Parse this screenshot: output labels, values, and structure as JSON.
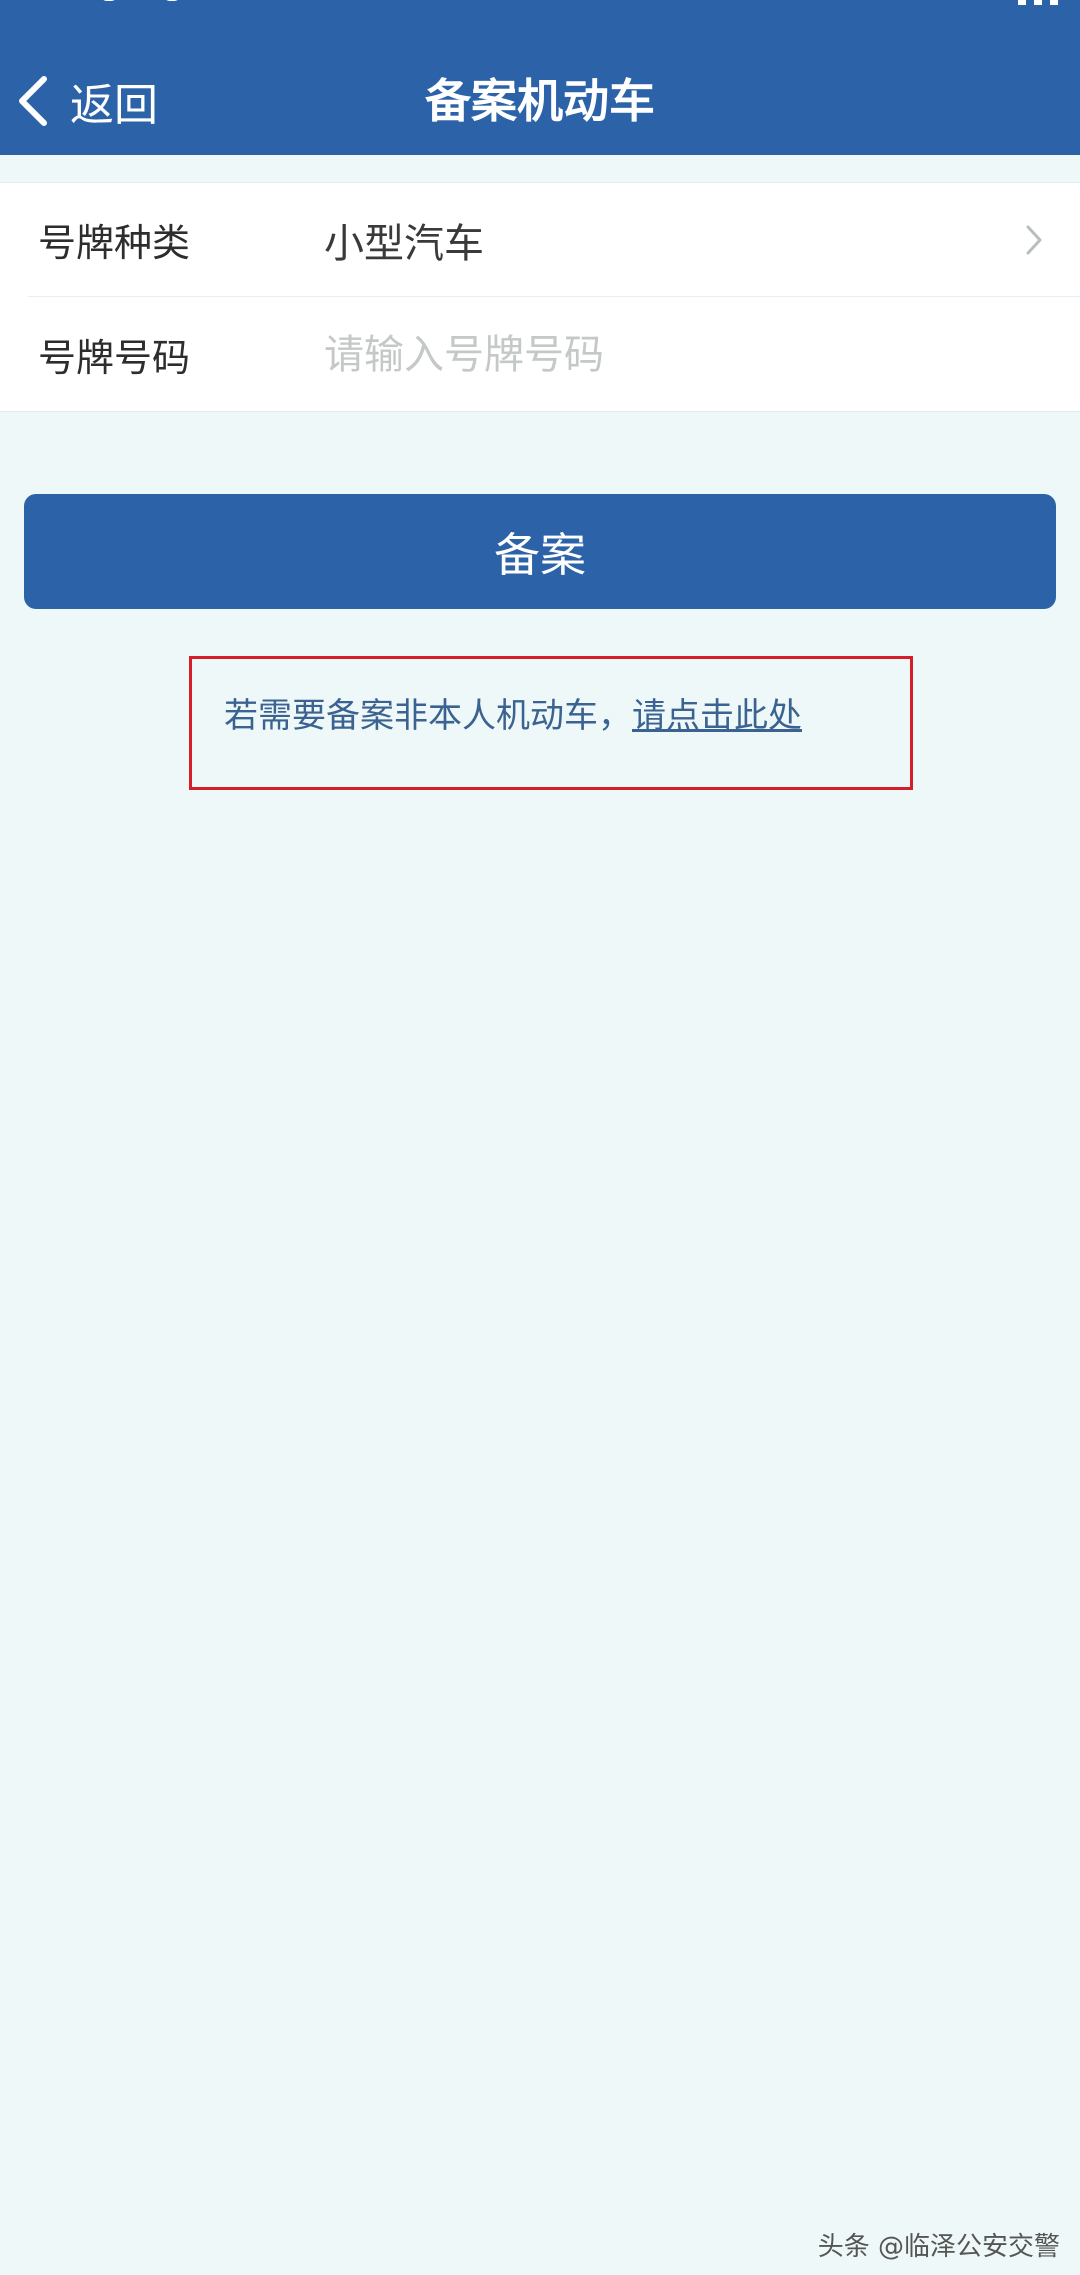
{
  "header": {
    "back_label": "返回",
    "title": "备案机动车",
    "background_color": "#2c63a8"
  },
  "form": {
    "plate_type": {
      "label": "号牌种类",
      "value": "小型汽车",
      "icon": "chevron-right-icon"
    },
    "plate_number": {
      "label": "号牌号码",
      "value": "",
      "placeholder": "请输入号牌号码"
    }
  },
  "actions": {
    "submit_label": "备案"
  },
  "notice": {
    "prefix": "若需要备案非本人机动车，",
    "link_text": "请点击此处",
    "highlight_color": "#d51e2a"
  },
  "watermark": {
    "text": "头条 @临泽公安交警"
  }
}
